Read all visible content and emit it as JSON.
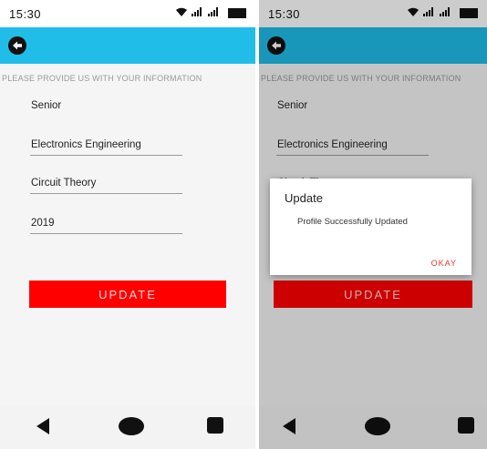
{
  "status_bar": {
    "time": "15:30"
  },
  "form": {
    "instruction": "PLEASE PROVIDE US WITH YOUR INFORMATION",
    "fields": [
      {
        "value": "Senior"
      },
      {
        "value": "Electronics Engineering"
      },
      {
        "value": "Circuit Theory"
      },
      {
        "value": "2019"
      }
    ],
    "update_label": "UPDATE"
  },
  "dialog": {
    "title": "Update",
    "message": "Profile Successfully Updated",
    "ok_label": "OKAY"
  },
  "colors": {
    "app_bar": "#20bde9",
    "update_button": "#ff0000",
    "dialog_ok": "#e53935"
  },
  "icons": {
    "back": "back-arrow-circle-icon",
    "wifi": "wifi-icon",
    "signal": "signal-icon",
    "battery": "battery-icon",
    "nav_back": "nav-back-icon",
    "nav_home": "nav-home-icon",
    "nav_recent": "nav-recent-icon"
  }
}
